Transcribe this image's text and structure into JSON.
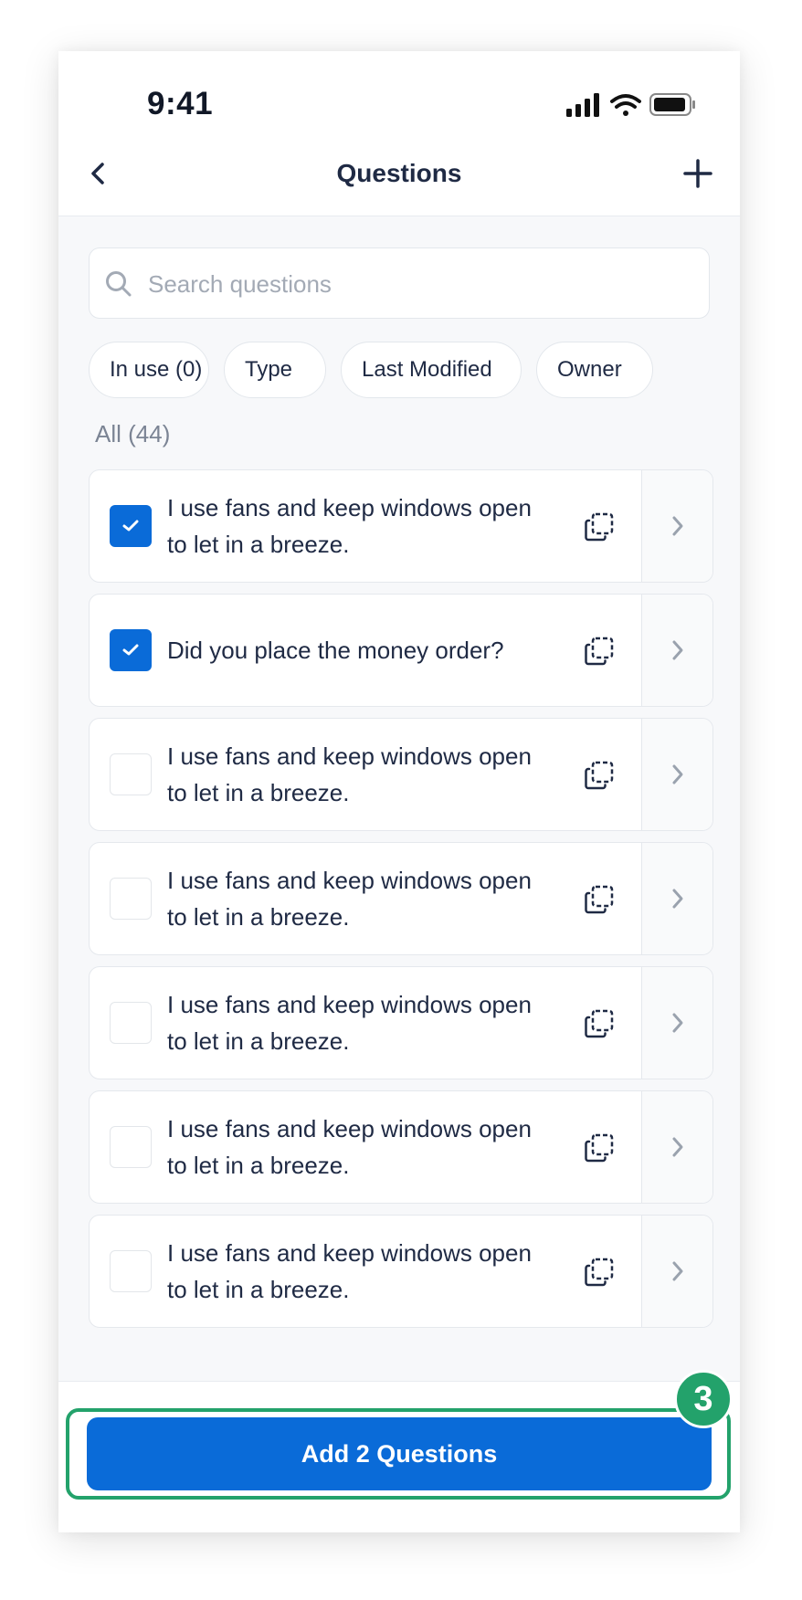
{
  "status_bar": {
    "time": "9:41"
  },
  "nav": {
    "title": "Questions",
    "back_icon": "chevron-left-icon",
    "add_icon": "plus-icon"
  },
  "search": {
    "placeholder": "Search questions",
    "value": ""
  },
  "filters": [
    {
      "label": "In use (0)",
      "dropdown": false
    },
    {
      "label": "Type",
      "dropdown": true
    },
    {
      "label": "Last Modified",
      "dropdown": true
    },
    {
      "label": "Owner",
      "dropdown": true
    }
  ],
  "section": {
    "label": "All (44)"
  },
  "questions": [
    {
      "line1": "I use fans and keep windows open",
      "line2": "to let in a breeze.",
      "checked": true
    },
    {
      "line1": "Did you place the money order?",
      "line2": "",
      "checked": true
    },
    {
      "line1": "I use fans and keep windows open",
      "line2": "to let in a breeze.",
      "checked": false
    },
    {
      "line1": "I use fans and keep windows open",
      "line2": "to let in a breeze.",
      "checked": false
    },
    {
      "line1": "I use fans and keep windows open",
      "line2": "to let in a breeze.",
      "checked": false
    },
    {
      "line1": "I use fans and keep windows open",
      "line2": "to let in a breeze.",
      "checked": false
    },
    {
      "line1": "I use fans and keep windows open",
      "line2": "to let in a breeze.",
      "checked": false
    }
  ],
  "footer": {
    "button_label": "Add 2 Questions",
    "step_number": "3"
  },
  "colors": {
    "primary": "#0a6bd8",
    "highlight": "#23a26b",
    "text": "#1f2a44",
    "muted": "#7b8494"
  }
}
